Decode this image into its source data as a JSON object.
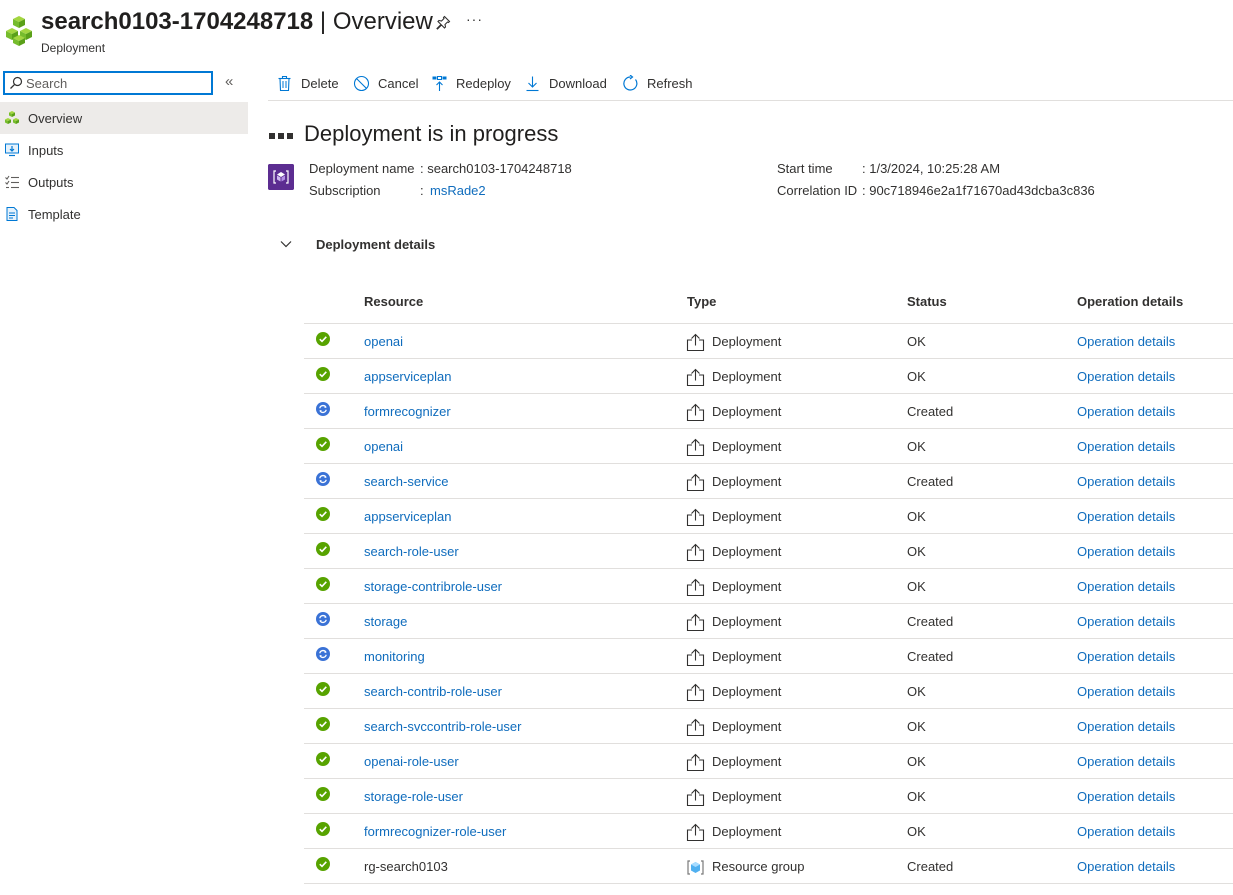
{
  "header": {
    "title": "search0103-1704248718",
    "title_sep": " | Overview",
    "subtitle": "Deployment",
    "more_label": "···"
  },
  "sidebar": {
    "search_placeholder": "Search",
    "collapse_label": "«",
    "items": [
      {
        "label": "Overview",
        "icon": "deployment-cubes-icon",
        "active": true
      },
      {
        "label": "Inputs",
        "icon": "inputs-icon",
        "active": false
      },
      {
        "label": "Outputs",
        "icon": "outputs-icon",
        "active": false
      },
      {
        "label": "Template",
        "icon": "template-icon",
        "active": false
      }
    ]
  },
  "toolbar": {
    "delete_label": "Delete",
    "cancel_label": "Cancel",
    "redeploy_label": "Redeploy",
    "download_label": "Download",
    "refresh_label": "Refresh"
  },
  "main": {
    "heading": "Deployment is in progress",
    "deployment_name_label": "Deployment name",
    "deployment_name_value": ": search0103-1704248718",
    "subscription_label": "Subscription",
    "subscription_colon": ":",
    "subscription_value": "msRade2",
    "start_time_label": "Start time",
    "start_time_value": ": 1/3/2024, 10:25:28 AM",
    "correlation_label": "Correlation ID",
    "correlation_value": ": 90c718946e2a1f71670ad43dcba3c836",
    "details_title": "Deployment details"
  },
  "colors": {
    "ok_green": "#57a300",
    "created_blue": "#3a72d6",
    "link_blue": "#0f6cbd",
    "deployment_icon_purple": "#5c2d91"
  },
  "table": {
    "headers": {
      "resource": "Resource",
      "type": "Type",
      "status": "Status",
      "operation": "Operation details"
    },
    "rows": [
      {
        "resource": "openai",
        "type": "Deployment",
        "status": "OK",
        "operation": "Operation details",
        "icon": "check-circle-icon",
        "link": true
      },
      {
        "resource": "appserviceplan",
        "type": "Deployment",
        "status": "OK",
        "operation": "Operation details",
        "icon": "check-circle-icon",
        "link": true
      },
      {
        "resource": "formrecognizer",
        "type": "Deployment",
        "status": "Created",
        "operation": "Operation details",
        "icon": "in-progress-icon",
        "link": true
      },
      {
        "resource": "openai",
        "type": "Deployment",
        "status": "OK",
        "operation": "Operation details",
        "icon": "check-circle-icon",
        "link": true
      },
      {
        "resource": "search-service",
        "type": "Deployment",
        "status": "Created",
        "operation": "Operation details",
        "icon": "in-progress-icon",
        "link": true
      },
      {
        "resource": "appserviceplan",
        "type": "Deployment",
        "status": "OK",
        "operation": "Operation details",
        "icon": "check-circle-icon",
        "link": true
      },
      {
        "resource": "search-role-user",
        "type": "Deployment",
        "status": "OK",
        "operation": "Operation details",
        "icon": "check-circle-icon",
        "link": true
      },
      {
        "resource": "storage-contribrole-user",
        "type": "Deployment",
        "status": "OK",
        "operation": "Operation details",
        "icon": "check-circle-icon",
        "link": true
      },
      {
        "resource": "storage",
        "type": "Deployment",
        "status": "Created",
        "operation": "Operation details",
        "icon": "in-progress-icon",
        "link": true
      },
      {
        "resource": "monitoring",
        "type": "Deployment",
        "status": "Created",
        "operation": "Operation details",
        "icon": "in-progress-icon",
        "link": true
      },
      {
        "resource": "search-contrib-role-user",
        "type": "Deployment",
        "status": "OK",
        "operation": "Operation details",
        "icon": "check-circle-icon",
        "link": true
      },
      {
        "resource": "search-svccontrib-role-user",
        "type": "Deployment",
        "status": "OK",
        "operation": "Operation details",
        "icon": "check-circle-icon",
        "link": true
      },
      {
        "resource": "openai-role-user",
        "type": "Deployment",
        "status": "OK",
        "operation": "Operation details",
        "icon": "check-circle-icon",
        "link": true
      },
      {
        "resource": "storage-role-user",
        "type": "Deployment",
        "status": "OK",
        "operation": "Operation details",
        "icon": "check-circle-icon",
        "link": true
      },
      {
        "resource": "formrecognizer-role-user",
        "type": "Deployment",
        "status": "OK",
        "operation": "Operation details",
        "icon": "check-circle-icon",
        "link": true
      },
      {
        "resource": "rg-search0103",
        "type": "Resource group",
        "status": "Created",
        "operation": "Operation details",
        "icon": "check-circle-icon",
        "link": false
      }
    ]
  }
}
